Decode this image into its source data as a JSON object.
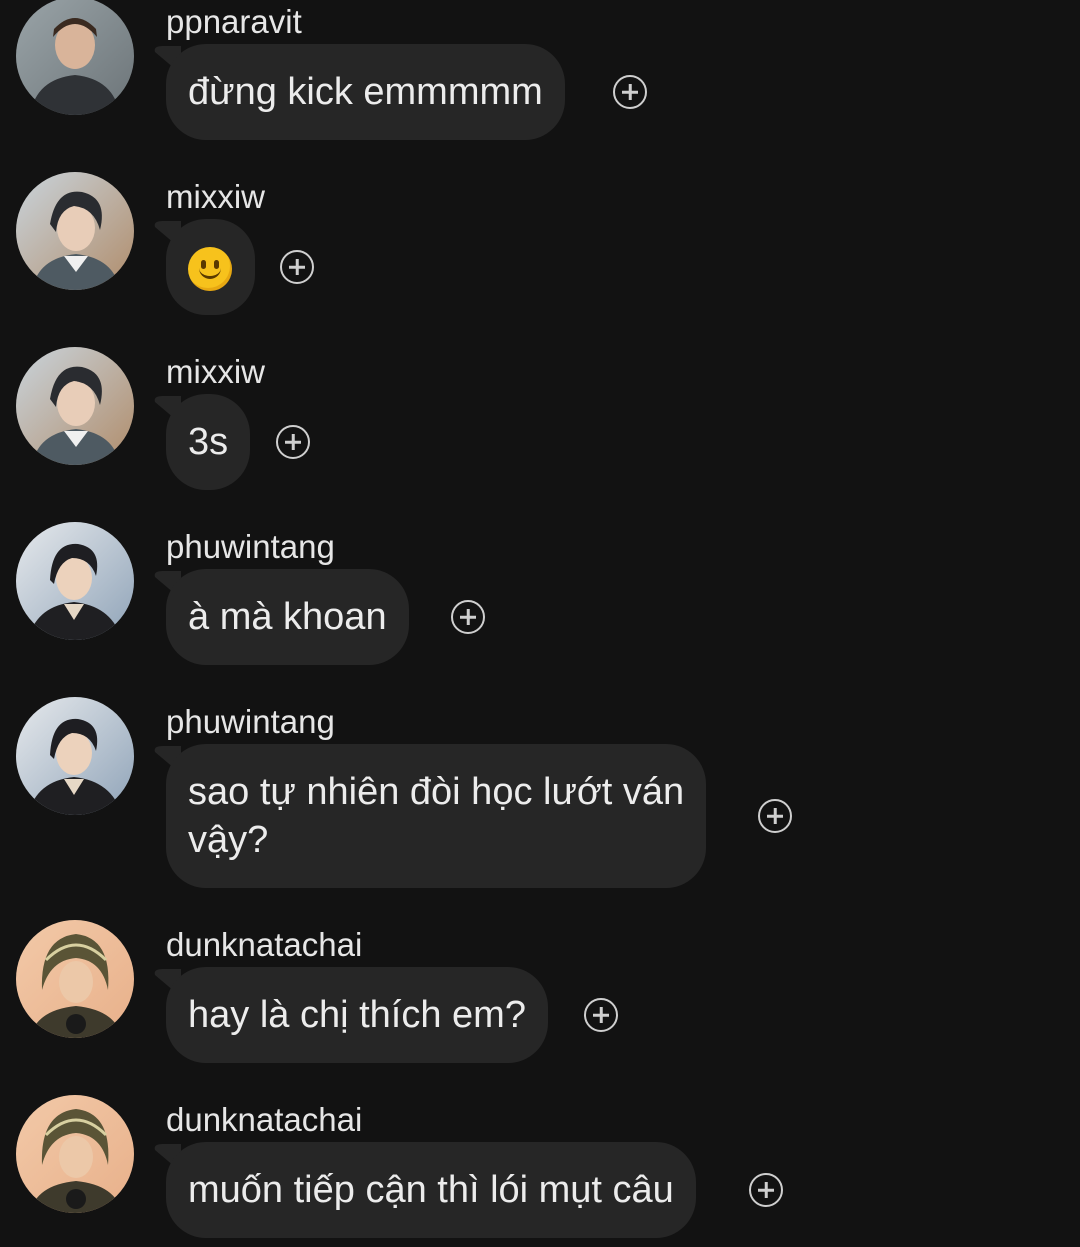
{
  "messages": [
    {
      "username": "ppnaravit",
      "text": "đừng kick emmmmm",
      "avatar": "avatar-ppnaravit"
    },
    {
      "username": "mixxiw",
      "emoji": "slightly-smiling-face-emoji",
      "avatar": "avatar-mixxiw"
    },
    {
      "username": "mixxiw",
      "text": "3s",
      "avatar": "avatar-mixxiw"
    },
    {
      "username": "phuwintang",
      "text": "à mà khoan",
      "avatar": "avatar-phuwintang"
    },
    {
      "username": "phuwintang",
      "text_line1": "sao tự nhiên đòi học lướt ván",
      "text_line2": "vậy?",
      "avatar": "avatar-phuwintang"
    },
    {
      "username": "dunknatachai",
      "text": "hay là chị thích em?",
      "avatar": "avatar-dunknatachai"
    },
    {
      "username": "dunknatachai",
      "text": "muốn tiếp cận thì lói mụt câu",
      "avatar": "avatar-dunknatachai"
    }
  ],
  "icons": {
    "react": "add-reaction-icon"
  },
  "colors": {
    "background": "#121212",
    "bubble": "#262626",
    "text": "#ececec"
  }
}
